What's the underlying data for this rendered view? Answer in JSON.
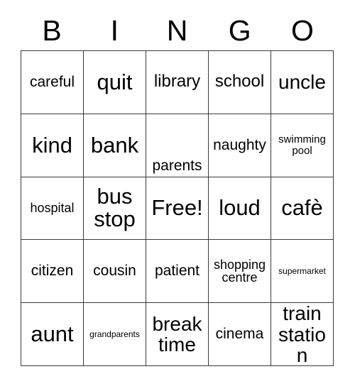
{
  "header": {
    "letters": [
      "B",
      "I",
      "N",
      "G",
      "O"
    ]
  },
  "grid": {
    "rows": 5,
    "columns": 5,
    "border_color": "#3a3a3a",
    "background_color": "#ffffff",
    "text_color": "#000000",
    "free_space": "Free!",
    "cells": [
      [
        {
          "text": "careful",
          "size": "md"
        },
        {
          "text": "quit",
          "size": "xxl"
        },
        {
          "text": "library",
          "size": "lg"
        },
        {
          "text": "school",
          "size": "lg"
        },
        {
          "text": "uncle",
          "size": "xl"
        }
      ],
      [
        {
          "text": "kind",
          "size": "xxl"
        },
        {
          "text": "bank",
          "size": "xxl"
        },
        {
          "text": "parents",
          "size": "md",
          "align": "bottom"
        },
        {
          "text": "naughty",
          "size": "md"
        },
        {
          "text": "swimming pool",
          "size": "xs"
        }
      ],
      [
        {
          "text": "hospital",
          "size": "sm"
        },
        {
          "text": "bus stop",
          "size": "xxl"
        },
        {
          "text": "Free!",
          "size": "xxl"
        },
        {
          "text": "loud",
          "size": "xxl"
        },
        {
          "text": "cafè",
          "size": "xxl"
        }
      ],
      [
        {
          "text": "citizen",
          "size": "md"
        },
        {
          "text": "cousin",
          "size": "md"
        },
        {
          "text": "patient",
          "size": "md"
        },
        {
          "text": "shopping centre",
          "size": "sm"
        },
        {
          "text": "supermarket",
          "size": "xxs"
        }
      ],
      [
        {
          "text": "aunt",
          "size": "xxl"
        },
        {
          "text": "grandparents",
          "size": "xxs"
        },
        {
          "text": "break time",
          "size": "xl"
        },
        {
          "text": "cinema",
          "size": "md"
        },
        {
          "text": "train station",
          "size": "xl"
        }
      ]
    ]
  }
}
